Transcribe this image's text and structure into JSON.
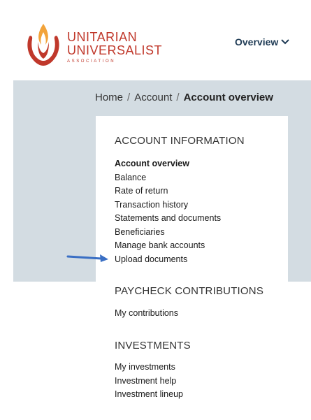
{
  "logo": {
    "line1": "UNITARIAN",
    "line2": "UNIVERSALIST",
    "line3": "ASSOCIATION",
    "brand_color": "#c0382b",
    "accent_color": "#f2a33a"
  },
  "nav": {
    "overview_label": "Overview",
    "chevron_icon": "chevron-down-icon"
  },
  "breadcrumb": {
    "home": "Home",
    "account": "Account",
    "current": "Account overview"
  },
  "sections": {
    "account_information": {
      "title": "ACCOUNT INFORMATION",
      "items": [
        "Account overview",
        "Balance",
        "Rate of return",
        "Transaction history",
        "Statements and documents",
        "Beneficiaries",
        "Manage bank accounts",
        "Upload documents"
      ]
    },
    "paycheck_contributions": {
      "title": "PAYCHECK CONTRIBUTIONS",
      "items": [
        "My contributions"
      ]
    },
    "investments": {
      "title": "INVESTMENTS",
      "items": [
        "My investments",
        "Investment help",
        "Investment lineup"
      ]
    }
  },
  "annotation": {
    "arrow_color": "#3a6fc4"
  }
}
